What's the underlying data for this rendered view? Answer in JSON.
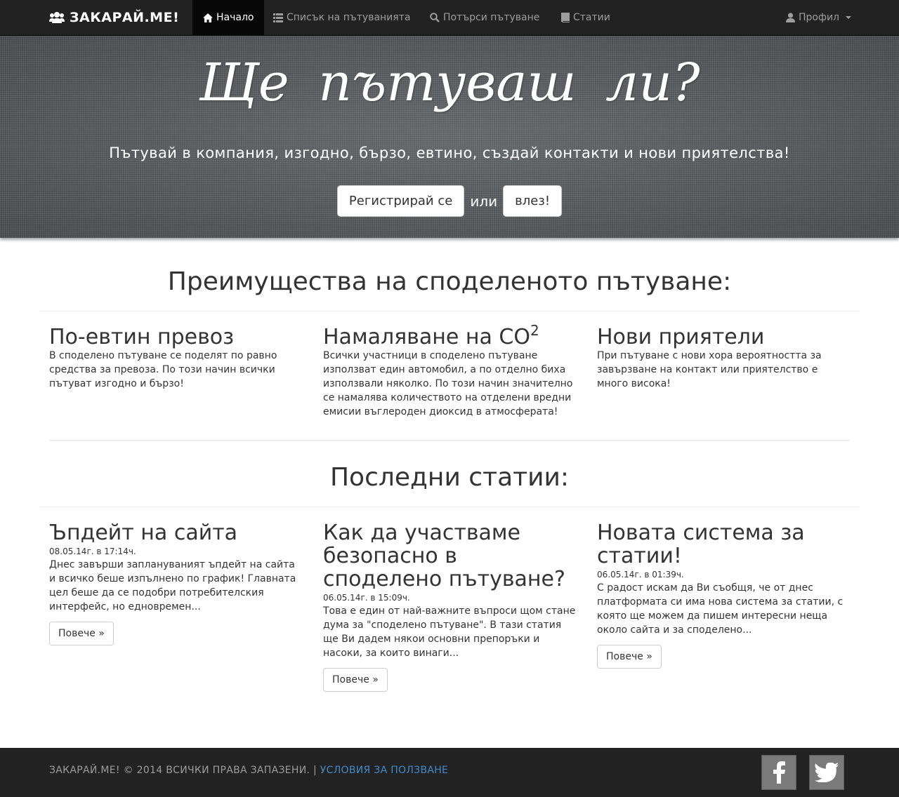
{
  "navbar": {
    "brand": "ЗАКАРАЙ.МЕ!",
    "items": [
      {
        "label": "Начало",
        "icon": "home-icon"
      },
      {
        "label": "Списък на пътуванията",
        "icon": "list-icon"
      },
      {
        "label": "Потърси пътуване",
        "icon": "search-icon"
      },
      {
        "label": "Статии",
        "icon": "book-icon"
      }
    ],
    "profile": "Профил"
  },
  "hero": {
    "title": "Ще пътуваш ли?",
    "subtitle": "Пътувай в компания, изгодно, бързо, евтино, създай контакти и нови приятелства!",
    "register_label": "Регистрирай се",
    "or_text": "или",
    "login_label": "влез!"
  },
  "benefits": {
    "title": "Преимущества на споделеното пътуване:",
    "items": [
      {
        "title": "По-евтин превоз",
        "text": "В споделено пътуване се поделят по равно средства за превоза. По този начин всички пътуват изгодно и бързо!"
      },
      {
        "title": "Намаляване на CO",
        "sup": "2",
        "text": "Всички участници в споделено пътуване използват един автомобил, а по отделно биха използвали няколко. По този начин значително се намалява количеството на отделени вредни емисии въглероден диоксид в атмосферата!"
      },
      {
        "title": "Нови приятели",
        "text": "При пътуване с нови хора вероятността за завързване на контакт или приятелство е много висока!"
      }
    ]
  },
  "articles": {
    "title": "Последни статии:",
    "more_label": "Повече »",
    "items": [
      {
        "title": "Ъпдейт на сайта",
        "date": "08.05.14г. в 17:14ч.",
        "excerpt": "Днес завърши заплануваният ъпдейт на сайта и всичко беше изпълнено по график! Главната цел беше да се подобри потребителския интерфейс, но едновремен..."
      },
      {
        "title": "Как да участваме безопасно в споделено пътуване?",
        "date": "06.05.14г. в 15:09ч.",
        "excerpt": "Това е един от най-важните въпроси щом стане дума за \"споделено пътуване\". В тази статия ще Ви дадем някои основни препоръки и насоки, за които винаги..."
      },
      {
        "title": "Новата система за статии!",
        "date": "06.05.14г. в 01:39ч.",
        "excerpt": "С радост искам да Ви съобщя, че от днес платформата си има нова система за статии, с която ще можем да пишем интересни неща около сайта и за споделено..."
      }
    ]
  },
  "footer": {
    "copyright": "ЗАКАРАЙ.МЕ! © 2014 ВСИЧКИ ПРАВА ЗАПАЗЕНИ. |",
    "terms_link": "УСЛОВИЯ ЗА ПОЛЗВАНЕ",
    "social": [
      "facebook-icon",
      "twitter-icon"
    ]
  },
  "colors": {
    "navbar_bg": "#222222",
    "nav_text": "#9d9d9d",
    "link": "#428bca",
    "hero_bg": "#5f6266"
  }
}
